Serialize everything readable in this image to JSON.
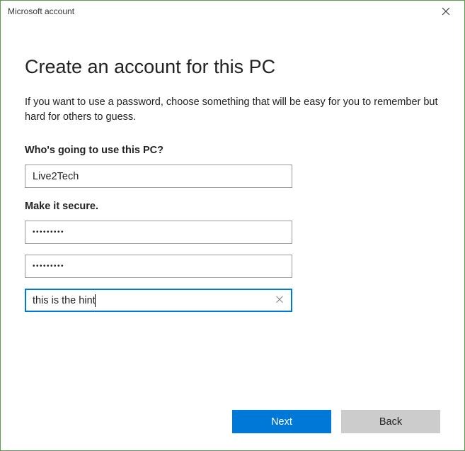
{
  "titlebar": {
    "title": "Microsoft account"
  },
  "heading": "Create an account for this PC",
  "subtext": "If you want to use a password, choose something that will be easy for you to remember but hard for others to guess.",
  "labels": {
    "username": "Who's going to use this PC?",
    "secure": "Make it secure."
  },
  "fields": {
    "username": "Live2Tech",
    "password": "•••••••••",
    "confirm": "•••••••••",
    "hint": "this is the hint"
  },
  "buttons": {
    "next": "Next",
    "back": "Back"
  }
}
